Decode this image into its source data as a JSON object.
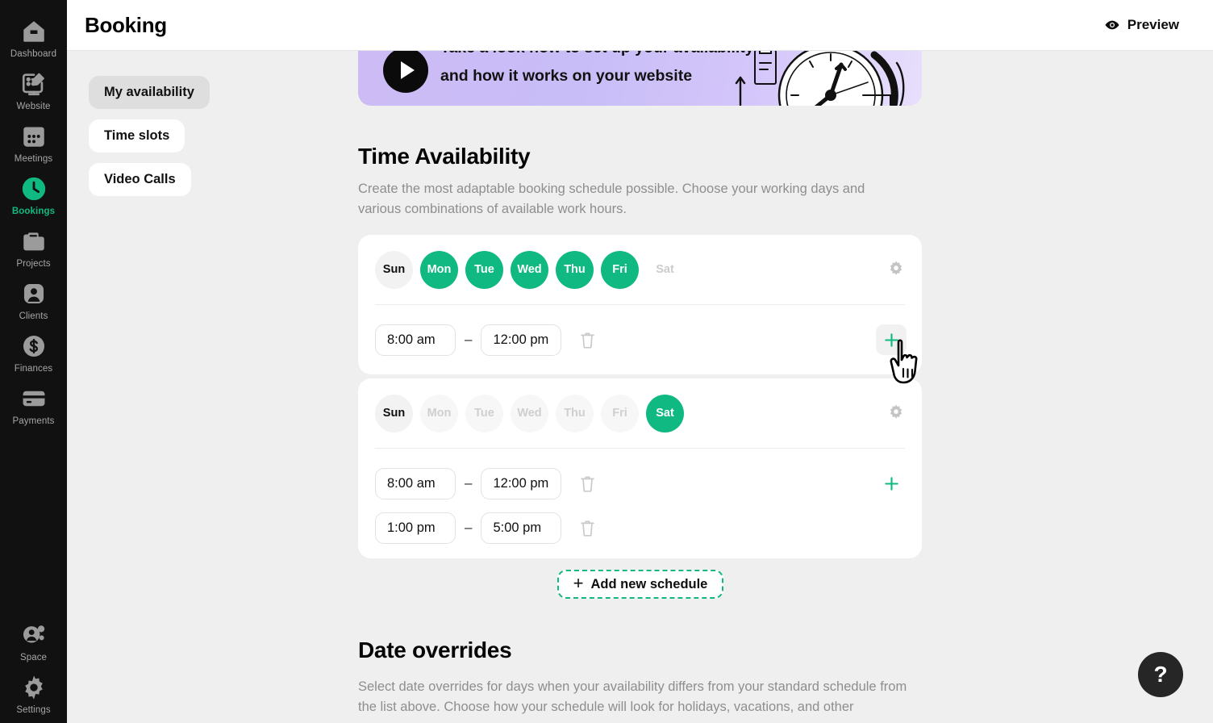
{
  "sidebar": {
    "items": [
      {
        "label": "Dashboard",
        "icon": "dashboard-icon",
        "active": false
      },
      {
        "label": "Website",
        "icon": "website-edit-icon",
        "active": false
      },
      {
        "label": "Meetings",
        "icon": "calendar-icon",
        "active": false
      },
      {
        "label": "Bookings",
        "icon": "clock-icon",
        "active": true
      },
      {
        "label": "Projects",
        "icon": "folder-icon",
        "active": false
      },
      {
        "label": "Clients",
        "icon": "user-icon",
        "active": false
      },
      {
        "label": "Finances",
        "icon": "dollar-circle-icon",
        "active": false
      },
      {
        "label": "Payments",
        "icon": "credit-card-icon",
        "active": false
      }
    ],
    "bottom_items": [
      {
        "label": "Space",
        "icon": "space-users-icon",
        "active": false
      },
      {
        "label": "Settings",
        "icon": "gear-icon",
        "active": false
      }
    ],
    "active_color": "#10b981"
  },
  "header": {
    "title": "Booking",
    "preview_label": "Preview",
    "preview_icon": "eye-icon"
  },
  "tabs": [
    {
      "label": "My availability",
      "selected": true
    },
    {
      "label": "Time slots",
      "selected": false
    },
    {
      "label": "Video Calls",
      "selected": false
    }
  ],
  "banner": {
    "line1": "Take a look how to set up your availability",
    "line2": "and how it works on your website",
    "play_icon": "play-icon",
    "art": "alarm-clock-illustration",
    "gradient_from": "#cdbbf5",
    "gradient_to": "#e7dffc"
  },
  "time_availability": {
    "heading": "Time Availability",
    "description": "Create the most adaptable booking schedule possible. Choose your working days and various combinations of available work hours.",
    "schedules": [
      {
        "days": [
          {
            "label": "Sun",
            "state": "neutral"
          },
          {
            "label": "Mon",
            "state": "on"
          },
          {
            "label": "Tue",
            "state": "on"
          },
          {
            "label": "Wed",
            "state": "on"
          },
          {
            "label": "Thu",
            "state": "on"
          },
          {
            "label": "Fri",
            "state": "on"
          },
          {
            "label": "Sat",
            "state": "off"
          }
        ],
        "settings_icon": "gear-icon",
        "time_ranges": [
          {
            "start": "8:00 am",
            "separator": "–",
            "end": "12:00 pm"
          }
        ],
        "add_icon": "plus-icon",
        "add_hovered": true,
        "delete_icon": "trash-icon"
      },
      {
        "days": [
          {
            "label": "Sun",
            "state": "neutral"
          },
          {
            "label": "Mon",
            "state": "ghost"
          },
          {
            "label": "Tue",
            "state": "ghost"
          },
          {
            "label": "Wed",
            "state": "ghost"
          },
          {
            "label": "Thu",
            "state": "ghost"
          },
          {
            "label": "Fri",
            "state": "ghost"
          },
          {
            "label": "Sat",
            "state": "on"
          }
        ],
        "settings_icon": "gear-icon",
        "time_ranges": [
          {
            "start": "8:00 am",
            "separator": "–",
            "end": "12:00 pm"
          },
          {
            "start": "1:00 pm",
            "separator": "–",
            "end": "5:00 pm"
          }
        ],
        "add_icon": "plus-icon",
        "add_hovered": false,
        "delete_icon": "trash-icon"
      }
    ],
    "add_schedule_label": "Add new schedule",
    "add_schedule_icon": "plus-icon"
  },
  "date_overrides": {
    "heading": "Date overrides",
    "description": "Select date overrides for days when your availability differs from your standard schedule from the list above. Choose how your schedule will look for holidays, vacations, and other"
  },
  "help": {
    "label": "?"
  },
  "cursor": {
    "icon": "pointer-hand-cursor"
  }
}
